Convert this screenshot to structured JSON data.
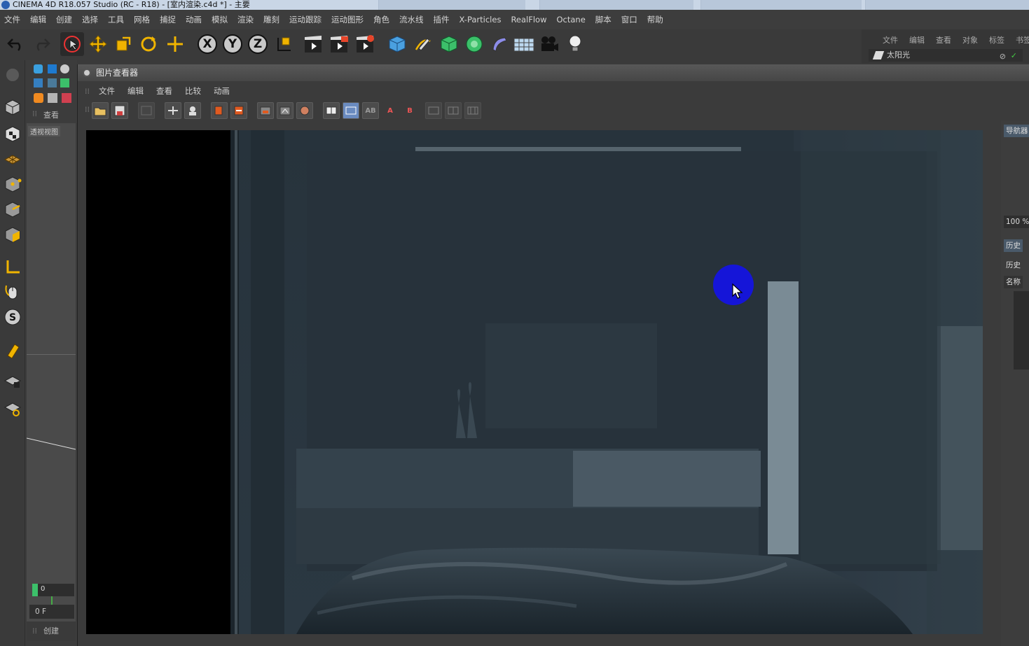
{
  "window": {
    "title": "CINEMA 4D R18.057 Studio (RC - R18) - [室内渲染.c4d *] - 主要"
  },
  "menubar": {
    "items": [
      "文件",
      "编辑",
      "创建",
      "选择",
      "工具",
      "网格",
      "捕捉",
      "动画",
      "模拟",
      "渲染",
      "雕刻",
      "运动跟踪",
      "运动图形",
      "角色",
      "流水线",
      "插件",
      "X-Particles",
      "RealFlow",
      "Octane",
      "脚本",
      "窗口",
      "帮助"
    ]
  },
  "object_manager": {
    "tabs": [
      "文件",
      "编辑",
      "查看",
      "对象",
      "标签",
      "书签"
    ],
    "object_name": "太阳光"
  },
  "left_strip": {
    "view_tab": "查看",
    "viewport_label": "透视视图",
    "frame_field": "0",
    "frame_label": "0 F",
    "create_tab": "创建"
  },
  "viewer": {
    "title": "图片查看器",
    "menu": [
      "文件",
      "编辑",
      "查看",
      "比较",
      "动画"
    ],
    "tool_labels": {
      "ab": "AB",
      "a": "A",
      "b": "B"
    }
  },
  "right_panel": {
    "navigator_tab": "导航器",
    "zoom": "100 %",
    "history_tab": "历史",
    "history_label": "历史",
    "name_label": "名称"
  },
  "colors": {
    "cursor_highlight": "#1515d8",
    "menu_bg": "#3d3d3d",
    "render_bg": "#1e2a33"
  }
}
